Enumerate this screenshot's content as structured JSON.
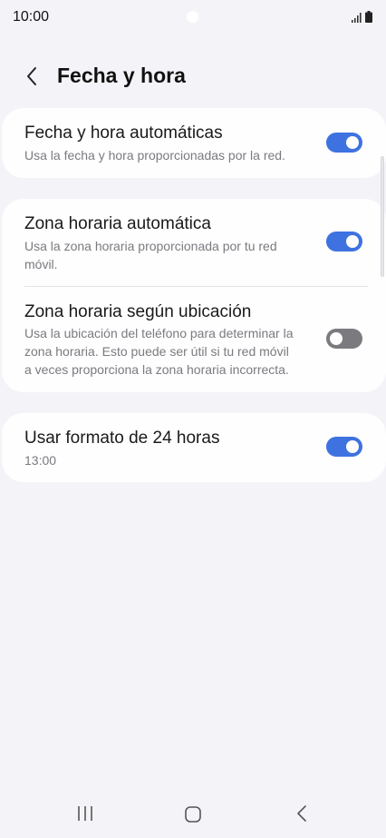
{
  "status_bar": {
    "time": "10:00",
    "icons": [
      "signal-icon",
      "battery-icon"
    ]
  },
  "header": {
    "back_icon": "chevron-left-icon",
    "title": "Fecha y hora"
  },
  "settings": {
    "auto_datetime": {
      "title": "Fecha y hora automáticas",
      "subtitle": "Usa la fecha y hora proporcionadas por la red.",
      "enabled": true
    },
    "auto_timezone": {
      "title": "Zona horaria automática",
      "subtitle_lines": [
        "Usa la zona horaria proporcionada por tu red",
        "móvil."
      ],
      "enabled": true
    },
    "location_timezone": {
      "title": "Zona horaria según ubicación",
      "subtitle_lines": [
        "Usa la ubicación del teléfono para determinar la",
        "zona horaria. Esto puede ser útil si tu red móvil",
        "a veces proporciona la zona horaria incorrecta."
      ],
      "enabled": false
    },
    "format_24h": {
      "title": "Usar formato de 24 horas",
      "subtitle": "13:00",
      "enabled": true
    }
  },
  "colors": {
    "toggle_on": "#3e72e0",
    "toggle_off": "#7b7b7f",
    "background": "#f4f4f8",
    "card": "#fefefe"
  },
  "nav_bar": {
    "icons": [
      "recents-icon",
      "home-icon",
      "back-icon"
    ]
  }
}
